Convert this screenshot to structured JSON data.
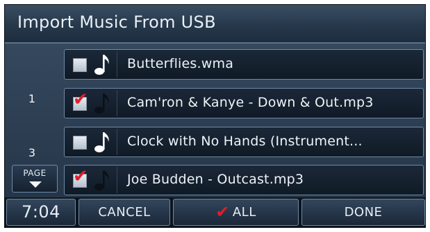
{
  "title": "Import Music From USB",
  "page_indicator": {
    "current": "1",
    "total": "3"
  },
  "page_button": {
    "label": "PAGE"
  },
  "files": [
    {
      "name": "Butterflies.wma",
      "checked": false,
      "note": "light"
    },
    {
      "name": "Cam'ron & Kanye - Down & Out.mp3",
      "checked": true,
      "note": "dark"
    },
    {
      "name": "Clock with No Hands (Instrument...",
      "checked": false,
      "note": "light"
    },
    {
      "name": "Joe Budden - Outcast.mp3",
      "checked": true,
      "note": "dark"
    }
  ],
  "bottom": {
    "clock": "7:04",
    "cancel": "CANCEL",
    "all": "ALL",
    "done": "DONE"
  },
  "colors": {
    "check": "#e01e2b",
    "background": "#1d2a39",
    "border": "#6f8aa6"
  },
  "icons": [
    "music-note-icon",
    "check-icon",
    "down-arrow-icon"
  ]
}
